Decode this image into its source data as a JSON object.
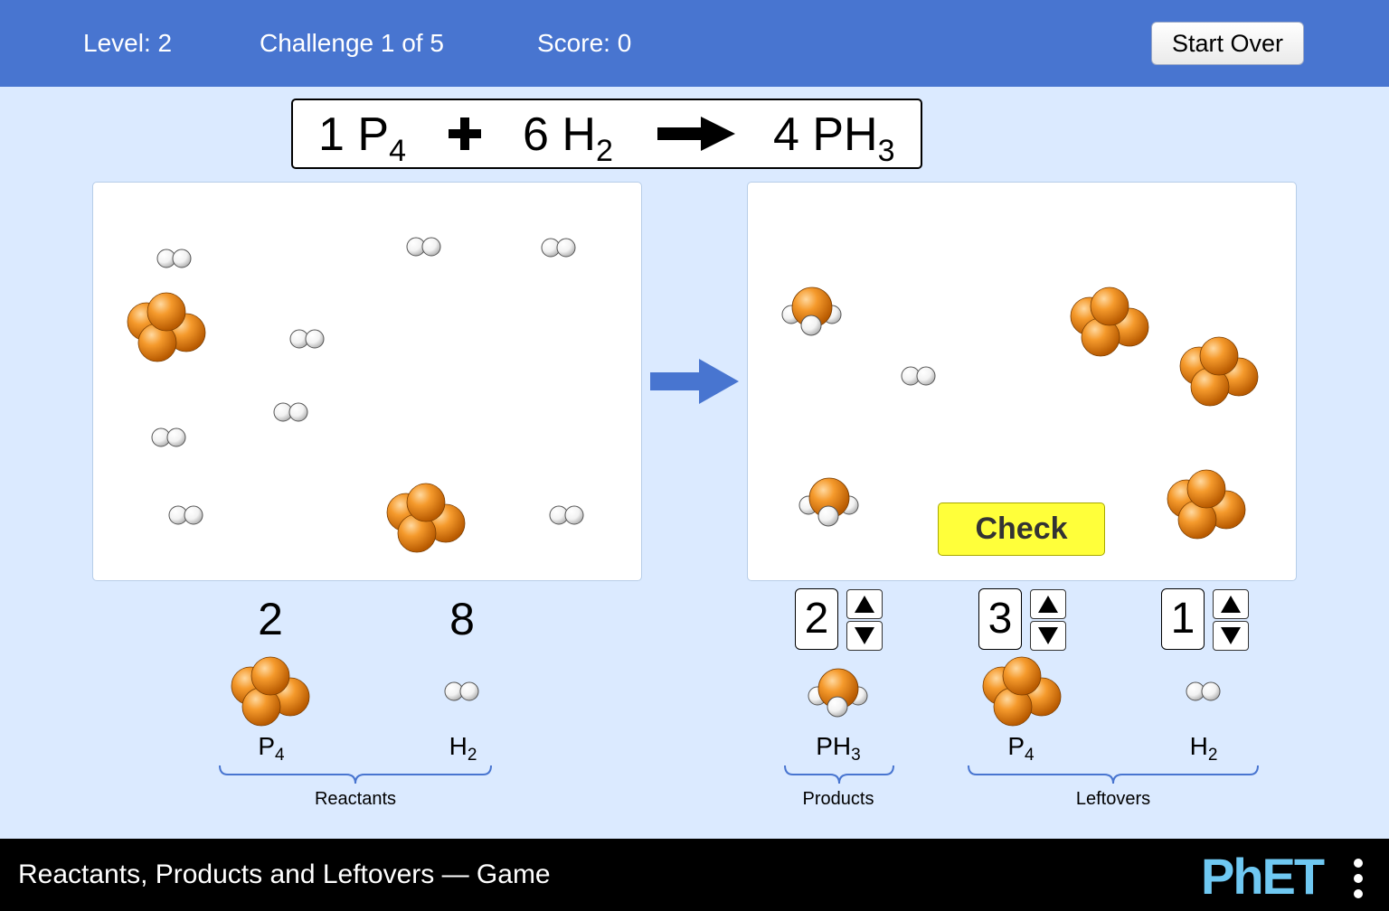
{
  "header": {
    "level": "Level: 2",
    "challenge": "Challenge 1 of 5",
    "score": "Score: 0",
    "start_over": "Start Over"
  },
  "equation": {
    "reactant1": {
      "coef": "1",
      "base": "P",
      "sub": "4"
    },
    "plus": "+",
    "reactant2": {
      "coef": "6",
      "base": "H",
      "sub": "2"
    },
    "product": {
      "coef": "4",
      "base": "PH",
      "sub": "3"
    }
  },
  "reactants": {
    "items": [
      {
        "count": "2",
        "base": "P",
        "sub": "4",
        "icon": "p4-molecule-icon"
      },
      {
        "count": "8",
        "base": "H",
        "sub": "2",
        "icon": "h2-molecule-icon"
      }
    ],
    "label": "Reactants"
  },
  "products": {
    "items": [
      {
        "count": "2",
        "base": "PH",
        "sub": "3",
        "icon": "ph3-molecule-icon"
      }
    ],
    "label": "Products"
  },
  "leftovers": {
    "items": [
      {
        "count": "3",
        "base": "P",
        "sub": "4",
        "icon": "p4-molecule-icon"
      },
      {
        "count": "1",
        "base": "H",
        "sub": "2",
        "icon": "h2-molecule-icon"
      }
    ],
    "label": "Leftovers"
  },
  "check_button": "Check",
  "footer": {
    "title": "Reactants, Products and Leftovers — Game",
    "logo": "PhET"
  },
  "colors": {
    "topbar": "#4875d0",
    "background": "#dbeaff",
    "phosphorus": "#f08a1c",
    "check_button": "#ffff3a",
    "arrow": "#4875d0"
  }
}
